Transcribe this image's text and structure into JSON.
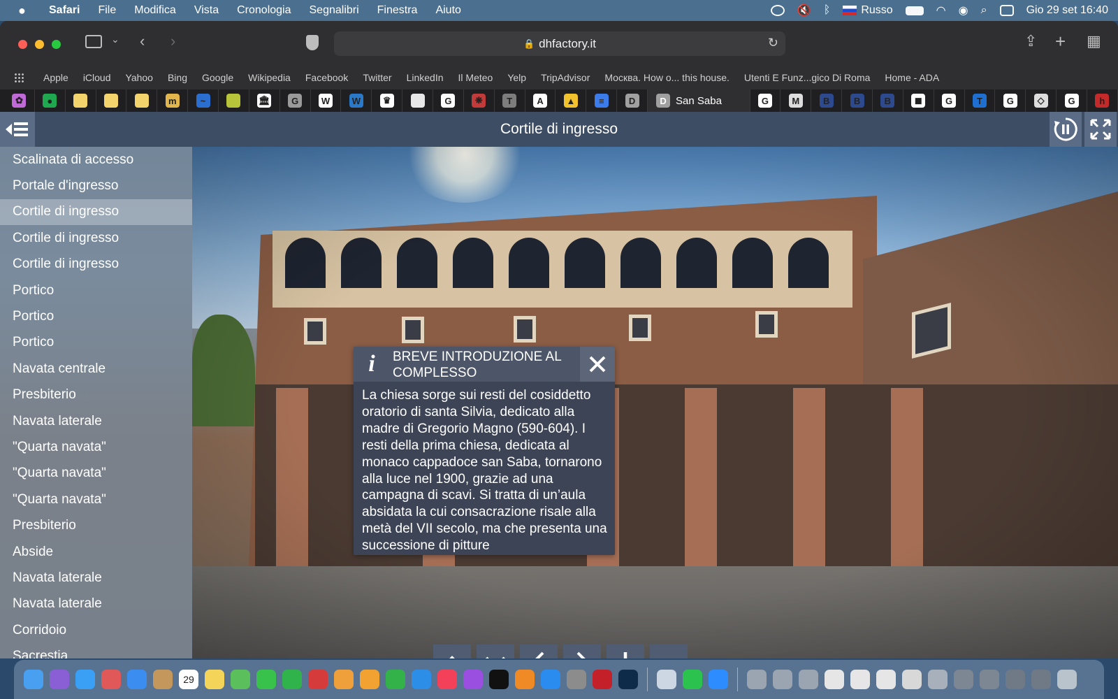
{
  "menubar": {
    "app": "Safari",
    "items": [
      "File",
      "Modifica",
      "Vista",
      "Cronologia",
      "Segnalibri",
      "Finestra",
      "Aiuto"
    ],
    "input_language": "Russo",
    "datetime": "Gio 29 set  16:40"
  },
  "browser": {
    "url": "dhfactory.it",
    "bookmarks": [
      "Apple",
      "iCloud",
      "Yahoo",
      "Bing",
      "Google",
      "Wikipedia",
      "Facebook",
      "Twitter",
      "LinkedIn",
      "Il Meteo",
      "Yelp",
      "TripAdvisor",
      "Москва. How o... this house.",
      "Utenti E Funz...gico Di Roma",
      "Home - ADA"
    ],
    "tabs_left": [
      {
        "icon": "colorful-flower-icon",
        "color": "#c06ad8",
        "glyph": "✿"
      },
      {
        "icon": "green-circle-icon",
        "color": "#1fa84f",
        "glyph": "●"
      },
      {
        "icon": "edr-icon",
        "color": "#f3d36b",
        "glyph": ""
      },
      {
        "icon": "edr-icon",
        "color": "#f3d36b",
        "glyph": ""
      },
      {
        "icon": "edr-icon",
        "color": "#f3d36b",
        "glyph": ""
      },
      {
        "icon": "m-logo-icon",
        "color": "#e2b64a",
        "glyph": "m"
      },
      {
        "icon": "swoosh-icon",
        "color": "#2a6fcf",
        "glyph": "~"
      },
      {
        "icon": "map-icon",
        "color": "#b8c43a",
        "glyph": ""
      },
      {
        "icon": "museum-icon",
        "color": "#ffffff",
        "glyph": "🏛"
      },
      {
        "icon": "g-gray-icon",
        "color": "#9a9a9a",
        "glyph": "G"
      },
      {
        "icon": "wikipedia-icon",
        "color": "#ffffff",
        "glyph": "W"
      },
      {
        "icon": "wordpress-icon",
        "color": "#2a78c8",
        "glyph": "W"
      },
      {
        "icon": "crest-icon",
        "color": "#ffffff",
        "glyph": "♛"
      },
      {
        "icon": "document-icon",
        "color": "#e7e7e7",
        "glyph": ""
      },
      {
        "icon": "google-icon",
        "color": "#ffffff",
        "glyph": "G"
      },
      {
        "icon": "red-seal-icon",
        "color": "#c23b3b",
        "glyph": "❋"
      },
      {
        "icon": "t-gray-icon",
        "color": "#7d7d7d",
        "glyph": "T"
      },
      {
        "icon": "a-serif-icon",
        "color": "#ffffff",
        "glyph": "A"
      },
      {
        "icon": "google-drive-icon",
        "color": "#f2c12e",
        "glyph": "▲"
      },
      {
        "icon": "google-docs-icon",
        "color": "#3b7bea",
        "glyph": "≡"
      },
      {
        "icon": "d-gray-icon",
        "color": "#a0a0a0",
        "glyph": "D"
      }
    ],
    "active_tab": {
      "title": "San Saba",
      "icon": "d-gray-icon",
      "glyph": "D"
    },
    "tabs_right": [
      {
        "icon": "google-icon",
        "color": "#ffffff",
        "glyph": "G"
      },
      {
        "icon": "mw-icon",
        "color": "#dddddd",
        "glyph": "M"
      },
      {
        "icon": "b-blue-icon",
        "color": "#2e4a8f",
        "glyph": "B"
      },
      {
        "icon": "b-blue-icon",
        "color": "#2e4a8f",
        "glyph": "B"
      },
      {
        "icon": "b-blue-icon",
        "color": "#2e4a8f",
        "glyph": "B"
      },
      {
        "icon": "black-white-icon",
        "color": "#ffffff",
        "glyph": "◼"
      },
      {
        "icon": "google-icon",
        "color": "#ffffff",
        "glyph": "G"
      },
      {
        "icon": "t-blue-icon",
        "color": "#1e6fd0",
        "glyph": "T"
      },
      {
        "icon": "google-icon",
        "color": "#ffffff",
        "glyph": "G"
      },
      {
        "icon": "diamond-icon",
        "color": "#dddddd",
        "glyph": "◇"
      },
      {
        "icon": "google-icon",
        "color": "#ffffff",
        "glyph": "G"
      },
      {
        "icon": "h2o-red-icon",
        "color": "#c42a2a",
        "glyph": "h"
      }
    ]
  },
  "viewer": {
    "title": "Cortile di ingresso",
    "menu": [
      "Scalinata di accesso",
      "Portale d'ingresso",
      "Cortile di ingresso",
      "Cortile di ingresso",
      "Cortile di ingresso",
      "Portico",
      "Portico",
      "Portico",
      "Navata centrale",
      "Presbiterio",
      "Navata laterale",
      "\"Quarta navata\"",
      "\"Quarta navata\"",
      "\"Quarta navata\"",
      "Presbiterio",
      "Abside",
      "Navata laterale",
      "Navata laterale",
      "Corridoio",
      "Sacrestia"
    ],
    "active_menu_index": 2,
    "info_popup": {
      "title": "BREVE INTRODUZIONE AL COMPLESSO",
      "body": "La chiesa sorge sui resti del cosiddetto oratorio di santa Silvia, dedicato alla madre di Gregorio Magno (590-604). I resti della prima chiesa, dedicata al monaco cappadoce san Saba, tornarono alla luce nel 1900, grazie ad una campagna di scavi. Si tratta di un’aula absidata la cui consacrazione risale alla metà del VII secolo, ma che presenta una successione di pitture"
    }
  },
  "dock": {
    "calendar_day": "29",
    "items": [
      {
        "icon": "finder-icon",
        "color": "#4aa0f0"
      },
      {
        "icon": "siri-icon",
        "color": "#8a5fd6"
      },
      {
        "icon": "safari-icon",
        "color": "#3aa0f5"
      },
      {
        "icon": "launchpad-icon",
        "color": "#e05858"
      },
      {
        "icon": "mail-icon",
        "color": "#3b8ef0"
      },
      {
        "icon": "contacts-icon",
        "color": "#c4985c"
      },
      {
        "icon": "calendar-icon",
        "color": "#ffffff"
      },
      {
        "icon": "notes-icon",
        "color": "#f5d45a"
      },
      {
        "icon": "maps-icon",
        "color": "#5bbf5b"
      },
      {
        "icon": "messages-icon",
        "color": "#38c24b"
      },
      {
        "icon": "facetime-icon",
        "color": "#2fb34a"
      },
      {
        "icon": "photo-booth-icon",
        "color": "#d63b3b"
      },
      {
        "icon": "photos-icon",
        "color": "#f0a03a"
      },
      {
        "icon": "pages-icon",
        "color": "#f2a230"
      },
      {
        "icon": "numbers-icon",
        "color": "#33b24a"
      },
      {
        "icon": "keynote-icon",
        "color": "#2d8ee8"
      },
      {
        "icon": "music-icon",
        "color": "#f3415a"
      },
      {
        "icon": "podcasts-icon",
        "color": "#9b4fe0"
      },
      {
        "icon": "apple-tv-icon",
        "color": "#111111"
      },
      {
        "icon": "books-icon",
        "color": "#f08a24"
      },
      {
        "icon": "app-store-icon",
        "color": "#2b8cf0"
      },
      {
        "icon": "system-preferences-icon",
        "color": "#8c8c8c"
      },
      {
        "icon": "autocad-icon",
        "color": "#c4202a"
      },
      {
        "icon": "photoshop-icon",
        "color": "#0f2b4a"
      },
      {
        "icon": "preview-icon",
        "color": "#cdd7e3"
      },
      {
        "icon": "whatsapp-icon",
        "color": "#2bc24e"
      },
      {
        "icon": "zoom-icon",
        "color": "#2d8cff"
      },
      {
        "icon": "recent-document-icon",
        "color": "#9aa5b1"
      },
      {
        "icon": "recent-document-icon",
        "color": "#9aa5b1"
      },
      {
        "icon": "recent-document-icon",
        "color": "#9aa5b1"
      },
      {
        "icon": "recent-document-icon",
        "color": "#e6e6e6"
      },
      {
        "icon": "recent-document-icon",
        "color": "#e6e6e6"
      },
      {
        "icon": "recent-document-icon",
        "color": "#e6e6e6"
      },
      {
        "icon": "recent-document-icon",
        "color": "#d8d8d8"
      },
      {
        "icon": "recent-document-icon",
        "color": "#a8b1bb"
      },
      {
        "icon": "recent-document-icon",
        "color": "#7d8793"
      },
      {
        "icon": "recent-document-icon",
        "color": "#7d8793"
      },
      {
        "icon": "recent-document-icon",
        "color": "#6f7a86"
      },
      {
        "icon": "recent-document-icon",
        "color": "#6f7a86"
      },
      {
        "icon": "trash-icon",
        "color": "#b9c3cc"
      }
    ]
  }
}
